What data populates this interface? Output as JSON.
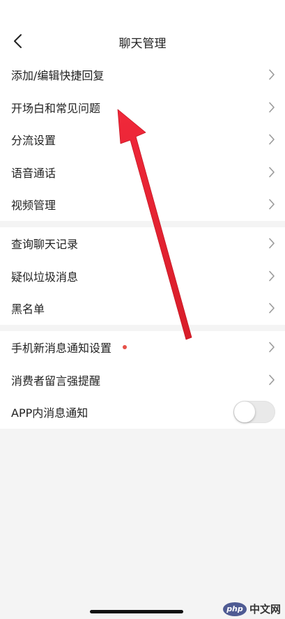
{
  "header": {
    "title": "聊天管理"
  },
  "groups": [
    {
      "items": [
        {
          "label": "添加/编辑快捷回复"
        },
        {
          "label": "开场白和常见问题"
        },
        {
          "label": "分流设置"
        },
        {
          "label": "语音通话"
        },
        {
          "label": "视频管理"
        }
      ]
    },
    {
      "items": [
        {
          "label": "查询聊天记录"
        },
        {
          "label": "疑似垃圾消息"
        },
        {
          "label": "黑名单"
        }
      ]
    },
    {
      "items": [
        {
          "label": "手机新消息通知设置"
        },
        {
          "label": "消费者留言强提醒"
        },
        {
          "label": "APP内消息通知",
          "toggle_on": false
        }
      ]
    }
  ],
  "watermark": {
    "logo_text": "php",
    "site_text": "中文网"
  },
  "colors": {
    "arrow": "#e8202d",
    "badge_dot": "#e65149",
    "background": "#f4f4f4"
  }
}
